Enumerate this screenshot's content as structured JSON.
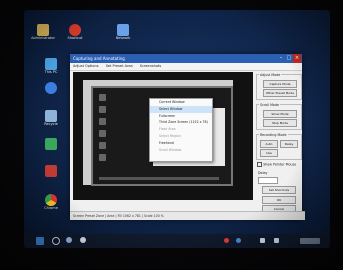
{
  "window": {
    "title": "Capturing and Annotating",
    "menu": [
      "Adjust Options",
      "Set Preset Area",
      "Screenshots"
    ]
  },
  "dropdown": {
    "items": [
      "Current Window",
      "Select Window",
      "Fullscreen",
      "Third Zone Screen (1152 x 78)",
      "Fixed Area",
      "Select Region",
      "Freehand",
      "Scroll Window"
    ],
    "selected_index": 1
  },
  "sidepanel": {
    "group1_title": "Adjust Mode",
    "group1_buttons": [
      "Capture Mode",
      "Other Preset Mode"
    ],
    "group2_title": "Scroll Mode",
    "group2_buttons": [
      "Show Mode",
      "Stop Mode"
    ],
    "group3_title": "Recording Mode",
    "group3_buttons": [
      "Auto",
      "Delay",
      "Use"
    ],
    "checkbox_label": "Show Pointer Mouse",
    "delay_label": "Delay",
    "bottom_buttons": [
      "Set Shortcuts",
      "OK",
      "Cancel"
    ]
  },
  "statusbar": {
    "text": "Screen Preset Zone | Area | Fill 1062 x 781 | Scale 100 %"
  },
  "desktop": {
    "icons": [
      "Administrator",
      "Shortcut",
      "Network",
      "This PC",
      "Recycle",
      "Chrome"
    ]
  },
  "colors": {
    "desktop_bg": "#0f2448",
    "titlebar": "#2b5fb3",
    "window_bg": "#f0f0f0"
  }
}
